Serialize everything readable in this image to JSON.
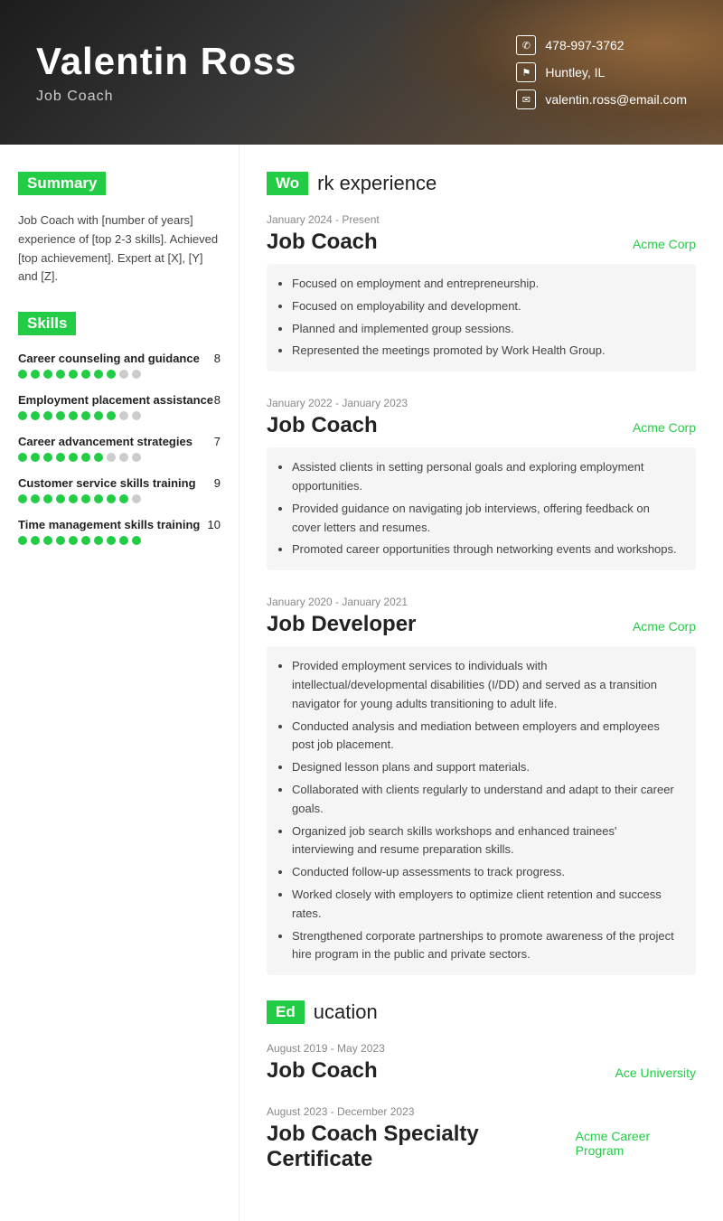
{
  "header": {
    "name": "Valentin Ross",
    "title": "Job Coach",
    "phone": "478-997-3762",
    "location": "Huntley, IL",
    "email": "valentin.ross@email.com"
  },
  "left": {
    "summary_label": "Summary",
    "summary_text": "Job Coach with [number of years] experience of [top 2-3 skills]. Achieved [top achievement]. Expert at [X], [Y] and [Z].",
    "skills_label": "Skills",
    "skills": [
      {
        "name": "Career counseling and guidance",
        "score": 8,
        "filled": 8,
        "total": 10
      },
      {
        "name": "Employment placement assistance",
        "score": 8,
        "filled": 8,
        "total": 10
      },
      {
        "name": "Career advancement strategies",
        "score": 7,
        "filled": 7,
        "total": 10
      },
      {
        "name": "Customer service skills training",
        "score": 9,
        "filled": 9,
        "total": 10
      },
      {
        "name": "Time management skills training",
        "score": 10,
        "filled": 10,
        "total": 10
      }
    ]
  },
  "right": {
    "work_label": "Work experience",
    "jobs": [
      {
        "date": "January 2024 - Present",
        "title": "Job Coach",
        "company": "Acme Corp",
        "bullets": [
          "Focused on employment and entrepreneurship.",
          "Focused on employability and development.",
          "Planned and implemented group sessions.",
          "Represented the meetings promoted by Work Health Group."
        ]
      },
      {
        "date": "January 2022 - January 2023",
        "title": "Job Coach",
        "company": "Acme Corp",
        "bullets": [
          "Assisted clients in setting personal goals and exploring employment opportunities.",
          "Provided guidance on navigating job interviews, offering feedback on cover letters and resumes.",
          "Promoted career opportunities through networking events and workshops."
        ]
      },
      {
        "date": "January 2020 - January 2021",
        "title": "Job Developer",
        "company": "Acme Corp",
        "bullets": [
          "Provided employment services to individuals with intellectual/developmental disabilities (I/DD) and served as a transition navigator for young adults transitioning to adult life.",
          "Conducted analysis and mediation between employers and employees post job placement.",
          "Designed lesson plans and support materials.",
          "Collaborated with clients regularly to understand and adapt to their career goals.",
          "Organized job search skills workshops and enhanced trainees' interviewing and resume preparation skills.",
          "Conducted follow-up assessments to track progress.",
          "Worked closely with employers to optimize client retention and success rates.",
          "Strengthened corporate partnerships to promote awareness of the project hire program in the public and private sectors."
        ]
      }
    ],
    "education_label": "Education",
    "education": [
      {
        "date": "August 2019 - May 2023",
        "title": "Job Coach",
        "institution": "Ace University"
      },
      {
        "date": "August 2023 - December 2023",
        "title": "Job Coach Specialty Certificate",
        "institution": "Acme Career Program"
      }
    ]
  }
}
